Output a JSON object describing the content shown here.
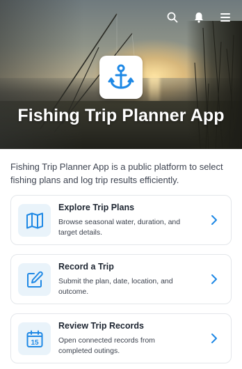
{
  "header": {
    "title": "Fishing Trip Planner App",
    "actions": [
      {
        "icon": "search-icon"
      },
      {
        "icon": "bell-icon"
      },
      {
        "icon": "menu-icon"
      }
    ],
    "logo_icon": "anchor-icon"
  },
  "intro": {
    "text": "Fishing Trip Planner App is a public platform to select fishing plans and log trip results efficiently."
  },
  "cards": [
    {
      "icon": "map-icon",
      "title": "Explore Trip Plans",
      "description": "Browse seasonal water, duration, and target details."
    },
    {
      "icon": "edit-icon",
      "title": "Record a Trip",
      "description": "Submit the plan, date, location, and outcome."
    },
    {
      "icon": "calendar-icon",
      "title": "Review Trip Records",
      "description": "Open connected records from completed outings."
    }
  ],
  "calendar_day": "15",
  "colors": {
    "accent": "#1e88e5",
    "icon_bg": "#e9f3fa",
    "card_border": "#e3e6ea",
    "title_text": "#1c2430",
    "body_text": "#3d4350"
  }
}
